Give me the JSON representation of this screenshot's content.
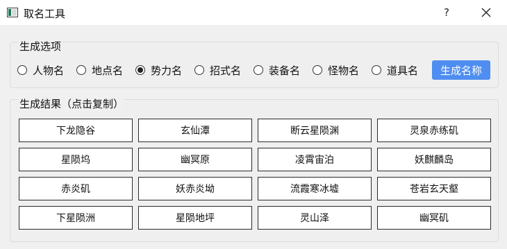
{
  "window": {
    "title": "取名工具",
    "help_label": "?",
    "icon": "app-window-icon",
    "close_icon": "close-icon"
  },
  "options": {
    "group_title": "生成选项",
    "radios": [
      {
        "label": "人物名",
        "checked": false
      },
      {
        "label": "地点名",
        "checked": false
      },
      {
        "label": "势力名",
        "checked": true
      },
      {
        "label": "招式名",
        "checked": false
      },
      {
        "label": "装备名",
        "checked": false
      },
      {
        "label": "怪物名",
        "checked": false
      },
      {
        "label": "道具名",
        "checked": false
      }
    ],
    "generate_label": "生成名称",
    "accent_color": "#4f8ef0"
  },
  "results": {
    "group_title": "生成结果（点击复制）",
    "names": [
      "下龙隐谷",
      "玄仙潭",
      "断云星陨渊",
      "灵泉赤练矶",
      "星陨坞",
      "幽冥原",
      "凌霄宙泊",
      "妖麒麟岛",
      "赤炎矶",
      "妖赤炎坳",
      "流霞寒冰墟",
      "苍岩玄天壑",
      "下星陨洲",
      "星陨地坪",
      "灵山泽",
      "幽冥矶"
    ]
  }
}
